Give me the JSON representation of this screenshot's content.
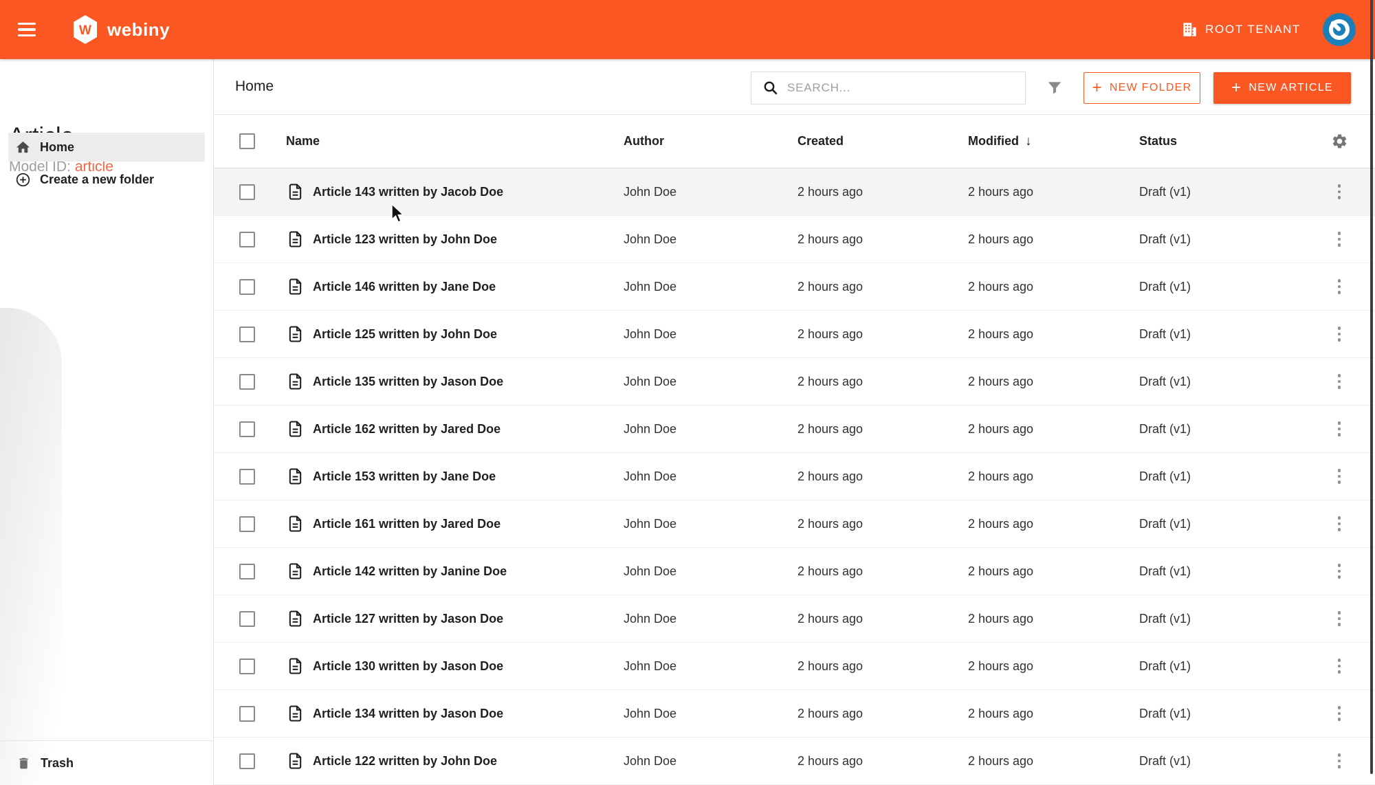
{
  "colors": {
    "accent": "#fa5723",
    "accent_light": "#f16648",
    "avatar_blue": "#1d7fba",
    "selected_row_bg": "#f4f4f4",
    "sidebar_selected_bg": "#ececec"
  },
  "header": {
    "brand": "webiny",
    "tenant_label": "ROOT TENANT"
  },
  "sidebar": {
    "title": "Article",
    "model_id_label": "Model ID:",
    "model_id_value": "article",
    "items": [
      {
        "label": "Home"
      },
      {
        "label": "Create a new folder"
      }
    ],
    "trash_label": "Trash"
  },
  "toolbar": {
    "breadcrumb": "Home",
    "search_placeholder": "SEARCH...",
    "new_folder_label": "NEW FOLDER",
    "new_article_label": "NEW ARTICLE"
  },
  "table": {
    "columns": [
      "Name",
      "Author",
      "Created",
      "Modified",
      "Status"
    ],
    "sorted_column": "Modified",
    "sort_direction": "desc",
    "sort_indicator": "↓",
    "rows": [
      {
        "name": "Article 143 written by Jacob Doe",
        "author": "John Doe",
        "created": "2 hours ago",
        "modified": "2 hours ago",
        "status": "Draft (v1)",
        "highlighted": true
      },
      {
        "name": "Article 123 written by John Doe",
        "author": "John Doe",
        "created": "2 hours ago",
        "modified": "2 hours ago",
        "status": "Draft (v1)"
      },
      {
        "name": "Article 146 written by Jane Doe",
        "author": "John Doe",
        "created": "2 hours ago",
        "modified": "2 hours ago",
        "status": "Draft (v1)"
      },
      {
        "name": "Article 125 written by John Doe",
        "author": "John Doe",
        "created": "2 hours ago",
        "modified": "2 hours ago",
        "status": "Draft (v1)"
      },
      {
        "name": "Article 135 written by Jason Doe",
        "author": "John Doe",
        "created": "2 hours ago",
        "modified": "2 hours ago",
        "status": "Draft (v1)"
      },
      {
        "name": "Article 162 written by Jared Doe",
        "author": "John Doe",
        "created": "2 hours ago",
        "modified": "2 hours ago",
        "status": "Draft (v1)"
      },
      {
        "name": "Article 153 written by Jane Doe",
        "author": "John Doe",
        "created": "2 hours ago",
        "modified": "2 hours ago",
        "status": "Draft (v1)"
      },
      {
        "name": "Article 161 written by Jared Doe",
        "author": "John Doe",
        "created": "2 hours ago",
        "modified": "2 hours ago",
        "status": "Draft (v1)"
      },
      {
        "name": "Article 142 written by Janine Doe",
        "author": "John Doe",
        "created": "2 hours ago",
        "modified": "2 hours ago",
        "status": "Draft (v1)"
      },
      {
        "name": "Article 127 written by Jason Doe",
        "author": "John Doe",
        "created": "2 hours ago",
        "modified": "2 hours ago",
        "status": "Draft (v1)"
      },
      {
        "name": "Article 130 written by Jason Doe",
        "author": "John Doe",
        "created": "2 hours ago",
        "modified": "2 hours ago",
        "status": "Draft (v1)"
      },
      {
        "name": "Article 134 written by Jason Doe",
        "author": "John Doe",
        "created": "2 hours ago",
        "modified": "2 hours ago",
        "status": "Draft (v1)"
      },
      {
        "name": "Article 122 written by John Doe",
        "author": "John Doe",
        "created": "2 hours ago",
        "modified": "2 hours ago",
        "status": "Draft (v1)"
      }
    ]
  }
}
